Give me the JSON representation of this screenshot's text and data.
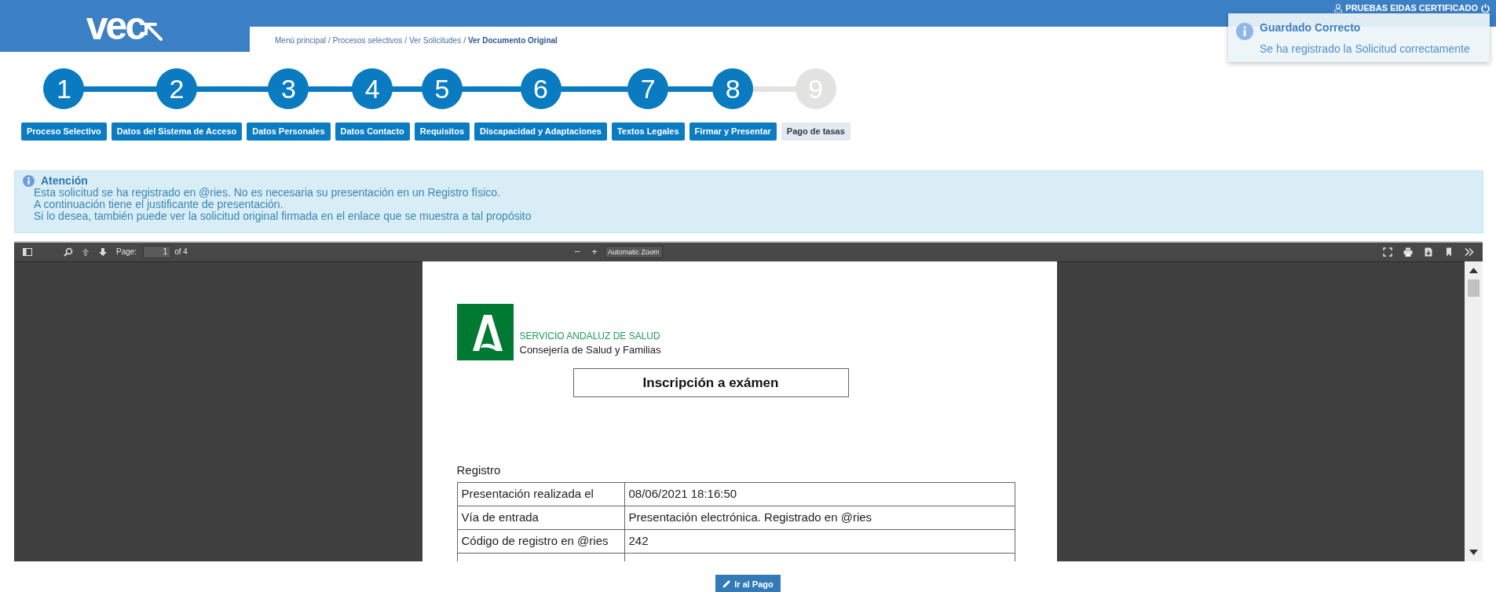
{
  "header": {
    "logo": "vec",
    "user": "PRUEBAS EIDAS CERTIFICADO"
  },
  "breadcrumb_separator": "/",
  "breadcrumb": [
    {
      "label": "Menú principal",
      "current": false
    },
    {
      "label": "Procesos selectivos",
      "current": false
    },
    {
      "label": "Ver Solicitudes",
      "current": false
    },
    {
      "label": "Ver Documento Original",
      "current": true
    }
  ],
  "toast": {
    "title": "Guardado Correcto",
    "message": "Se ha registrado la Solicitud correctamente"
  },
  "steps": [
    {
      "number": "1",
      "label": "Proceso Selectivo",
      "done": true
    },
    {
      "number": "2",
      "label": "Datos del Sistema de Acceso",
      "done": true
    },
    {
      "number": "3",
      "label": "Datos Personales",
      "done": true
    },
    {
      "number": "4",
      "label": "Datos Contacto",
      "done": true
    },
    {
      "number": "5",
      "label": "Requisitos",
      "done": true
    },
    {
      "number": "6",
      "label": "Discapacidad y Adaptaciones",
      "done": true
    },
    {
      "number": "7",
      "label": "Textos Legales",
      "done": true
    },
    {
      "number": "8",
      "label": "Firmar y Presentar",
      "done": true
    },
    {
      "number": "9",
      "label": "Pago de tasas",
      "done": false
    }
  ],
  "alert": {
    "title": "Atención",
    "lines": [
      "Esta solicitud se ha registrado en @ries. No es necesaria su presentación en un Registro físico.",
      "A continuación tiene el justificante de presentación.",
      "Si lo desea, también puede ver la solicitud original firmada en el enlace que se muestra a tal propósito"
    ]
  },
  "pdf_viewer": {
    "previous_page": {
      "disabled": true
    },
    "next_page": {
      "disabled": false
    },
    "page_label": "Page:",
    "page": "1",
    "page_count": "of 4",
    "zoom_out": "−",
    "zoom_in": "+",
    "zoom": "Automatic Zoom",
    "document": {
      "agency": "SERVICIO ANDALUZ DE SALUD",
      "department": "Consejería de Salud y Familias",
      "title": "Inscripción a exámen",
      "section": "Registro",
      "rows": [
        {
          "label": "Presentación realizada el",
          "value": "08/06/2021 18:16:50"
        },
        {
          "label": "Vía de entrada",
          "value": "Presentación electrónica. Registrado en @ries"
        },
        {
          "label": "Código de registro en @ries",
          "value": "242"
        }
      ]
    }
  },
  "buttons": [
    {
      "label": "Ir al Pago"
    }
  ]
}
